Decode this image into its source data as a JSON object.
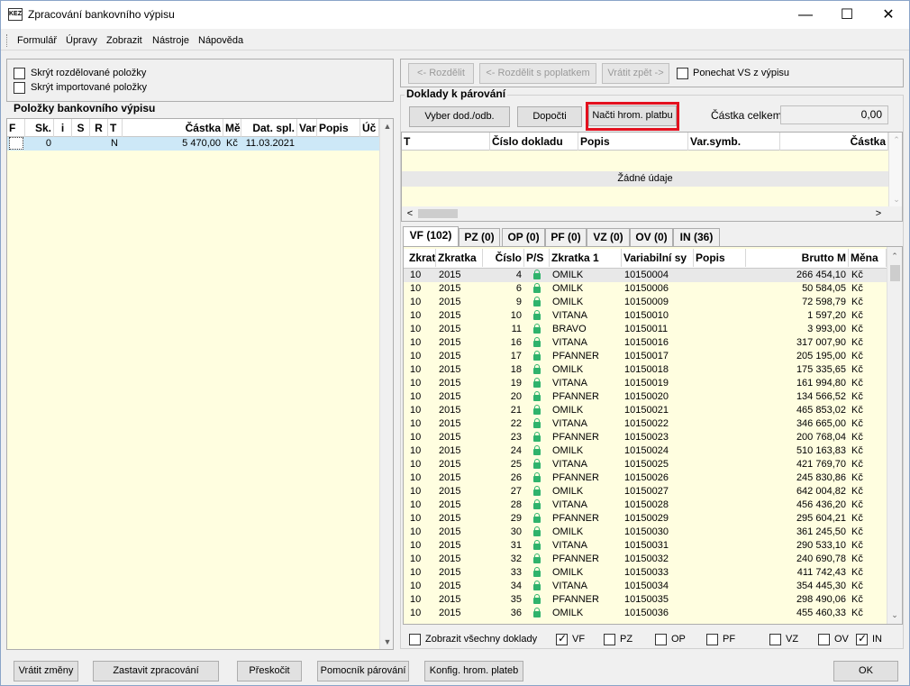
{
  "window": {
    "title": "Zpracování bankovního výpisu",
    "icon_text": "KEZ"
  },
  "menu": [
    "Formulář",
    "Úpravy",
    "Zobrazit",
    "Nástroje",
    "Nápověda"
  ],
  "left": {
    "hide_split_label": "Skrýt rozdělované položky",
    "hide_imported_label": "Skrýt importované položky",
    "group_title": "Položky bankovního výpisu",
    "columns": [
      "F",
      "Sk.",
      "i",
      "S",
      "R",
      "T",
      "Částka",
      "Mě",
      "Dat. spl.",
      "Var",
      "Popis",
      "Úč"
    ],
    "rows": [
      {
        "f": "",
        "sk": "0",
        "i": "",
        "s": "",
        "r": "",
        "t": "N",
        "castka": "5 470,00",
        "mena": "Kč",
        "datum": "11.03.2021",
        "var": "",
        "popis": "",
        "uc": ""
      }
    ]
  },
  "right": {
    "btn_split": "<- Rozdělit",
    "btn_split_fee": "<- Rozdělit s poplatkem",
    "btn_return": "Vrátit zpět ->",
    "keep_vs_label": "Ponechat VS z výpisu",
    "docs_title": "Doklady k párování",
    "btn_select": "Vyber dod./odb.",
    "btn_complete": "Dopočti",
    "btn_load_bulk": "Načti hrom. platbu",
    "total_label": "Částka celkem:",
    "total_value": "0,00",
    "docs_columns": [
      "T",
      "Číslo dokladu",
      "Popis",
      "Var.symb.",
      "Částka"
    ],
    "docs_empty": "Žádné údaje",
    "tabs": [
      "VF (102)",
      "PZ (0)",
      "OP (0)",
      "PF (0)",
      "VZ (0)",
      "OV (0)",
      "IN (36)"
    ],
    "list_columns": [
      "Zkrat",
      "Zkratka",
      "Číslo",
      "P/S",
      "Zkratka 1",
      "Variabilní sy",
      "Popis",
      "Brutto M",
      "Měna"
    ],
    "list_rows": [
      [
        "10",
        "2015",
        "4",
        "",
        "OMILK",
        "10150004",
        "",
        "266 454,10",
        "Kč"
      ],
      [
        "10",
        "2015",
        "6",
        "",
        "OMILK",
        "10150006",
        "",
        "50 584,05",
        "Kč"
      ],
      [
        "10",
        "2015",
        "9",
        "",
        "OMILK",
        "10150009",
        "",
        "72 598,79",
        "Kč"
      ],
      [
        "10",
        "2015",
        "10",
        "",
        "VITANA",
        "10150010",
        "",
        "1 597,20",
        "Kč"
      ],
      [
        "10",
        "2015",
        "11",
        "",
        "BRAVO",
        "10150011",
        "",
        "3 993,00",
        "Kč"
      ],
      [
        "10",
        "2015",
        "16",
        "",
        "VITANA",
        "10150016",
        "",
        "317 007,90",
        "Kč"
      ],
      [
        "10",
        "2015",
        "17",
        "",
        "PFANNER",
        "10150017",
        "",
        "205 195,00",
        "Kč"
      ],
      [
        "10",
        "2015",
        "18",
        "",
        "OMILK",
        "10150018",
        "",
        "175 335,65",
        "Kč"
      ],
      [
        "10",
        "2015",
        "19",
        "",
        "VITANA",
        "10150019",
        "",
        "161 994,80",
        "Kč"
      ],
      [
        "10",
        "2015",
        "20",
        "",
        "PFANNER",
        "10150020",
        "",
        "134 566,52",
        "Kč"
      ],
      [
        "10",
        "2015",
        "21",
        "",
        "OMILK",
        "10150021",
        "",
        "465 853,02",
        "Kč"
      ],
      [
        "10",
        "2015",
        "22",
        "",
        "VITANA",
        "10150022",
        "",
        "346 665,00",
        "Kč"
      ],
      [
        "10",
        "2015",
        "23",
        "",
        "PFANNER",
        "10150023",
        "",
        "200 768,04",
        "Kč"
      ],
      [
        "10",
        "2015",
        "24",
        "",
        "OMILK",
        "10150024",
        "",
        "510 163,83",
        "Kč"
      ],
      [
        "10",
        "2015",
        "25",
        "",
        "VITANA",
        "10150025",
        "",
        "421 769,70",
        "Kč"
      ],
      [
        "10",
        "2015",
        "26",
        "",
        "PFANNER",
        "10150026",
        "",
        "245 830,86",
        "Kč"
      ],
      [
        "10",
        "2015",
        "27",
        "",
        "OMILK",
        "10150027",
        "",
        "642 004,82",
        "Kč"
      ],
      [
        "10",
        "2015",
        "28",
        "",
        "VITANA",
        "10150028",
        "",
        "456 436,20",
        "Kč"
      ],
      [
        "10",
        "2015",
        "29",
        "",
        "PFANNER",
        "10150029",
        "",
        "295 604,21",
        "Kč"
      ],
      [
        "10",
        "2015",
        "30",
        "",
        "OMILK",
        "10150030",
        "",
        "361 245,50",
        "Kč"
      ],
      [
        "10",
        "2015",
        "31",
        "",
        "VITANA",
        "10150031",
        "",
        "290 533,10",
        "Kč"
      ],
      [
        "10",
        "2015",
        "32",
        "",
        "PFANNER",
        "10150032",
        "",
        "240 690,78",
        "Kč"
      ],
      [
        "10",
        "2015",
        "33",
        "",
        "OMILK",
        "10150033",
        "",
        "411 742,43",
        "Kč"
      ],
      [
        "10",
        "2015",
        "34",
        "",
        "VITANA",
        "10150034",
        "",
        "354 445,30",
        "Kč"
      ],
      [
        "10",
        "2015",
        "35",
        "",
        "PFANNER",
        "10150035",
        "",
        "298 490,06",
        "Kč"
      ],
      [
        "10",
        "2015",
        "36",
        "",
        "OMILK",
        "10150036",
        "",
        "455 460,33",
        "Kč"
      ]
    ],
    "show_all_label": "Zobrazit všechny doklady",
    "filters": [
      {
        "label": "VF",
        "checked": true
      },
      {
        "label": "PZ",
        "checked": false
      },
      {
        "label": "OP",
        "checked": false
      },
      {
        "label": "PF",
        "checked": false
      },
      {
        "label": "VZ",
        "checked": false
      },
      {
        "label": "OV",
        "checked": false
      },
      {
        "label": "IN",
        "checked": true
      }
    ]
  },
  "bottom": {
    "btn_revert": "Vrátit změny",
    "btn_stop": "Zastavit zpracování",
    "btn_skip": "Přeskočit",
    "btn_helper": "Pomocník párování",
    "btn_config": "Konfig. hrom. plateb",
    "btn_ok": "OK"
  },
  "colors": {
    "highlight_border": "#e3101e",
    "grid_bg": "#fffee0",
    "selected_row": "#cde8f7",
    "lock": "#2fb36c"
  }
}
